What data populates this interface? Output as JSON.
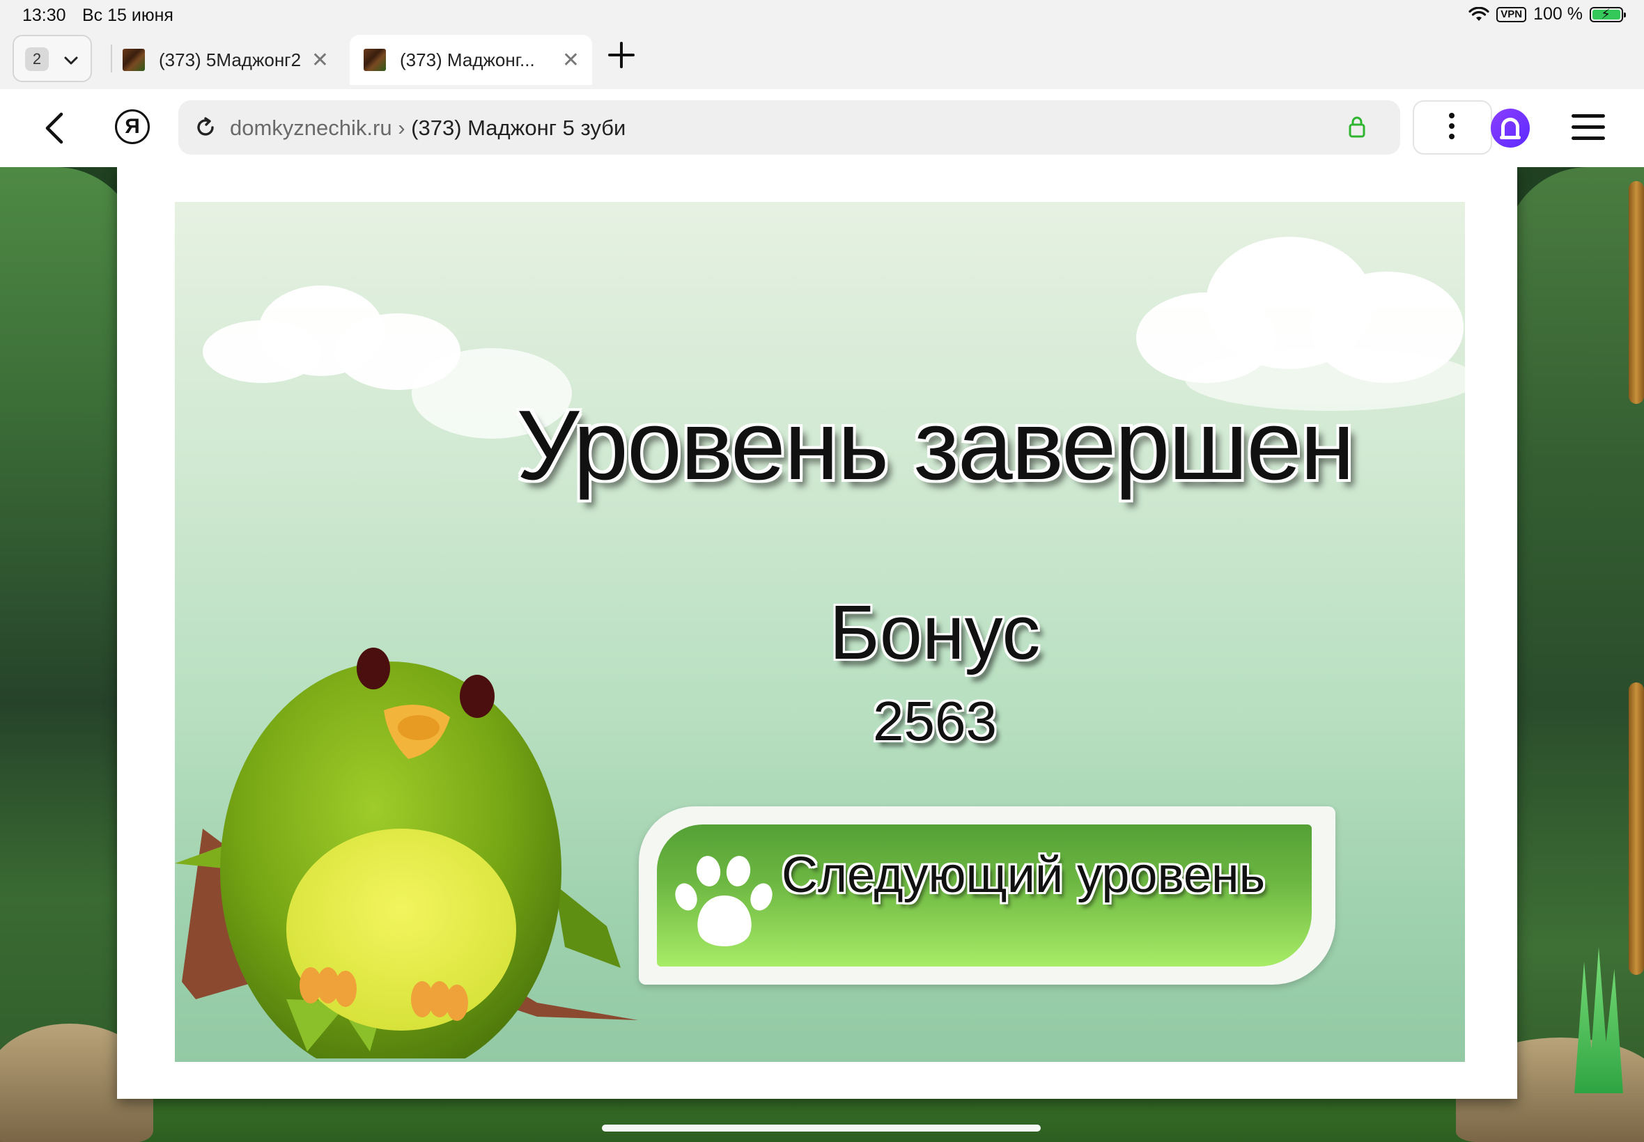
{
  "status_bar": {
    "time": "13:30",
    "date": "Вс 15 июня",
    "vpn": "VPN",
    "battery_text": "100 %",
    "battery_level": 1.0
  },
  "tabs": {
    "count": "2",
    "items": [
      {
        "title": "(373) 5Маджонг2",
        "active": false
      },
      {
        "title": "(373) Маджонг...",
        "active": true
      }
    ]
  },
  "toolbar": {
    "ya_label": "Я",
    "address": {
      "domain": "domkyznechik.ru",
      "separator": " › ",
      "page_title": "(373) Маджонг 5 зуби"
    }
  },
  "game": {
    "headline": "Уровень завершен",
    "bonus_label": "Бонус",
    "bonus_value": "2563",
    "next_button_label": "Следующий уровень"
  },
  "colors": {
    "accent_alice": "#7b3cff",
    "lock_green": "#2fb52f",
    "button_green": "#6cb742"
  },
  "icons": [
    "back-arrow-icon",
    "yandex-icon",
    "reload-icon",
    "lock-icon",
    "more-dots-icon",
    "alice-icon",
    "hamburger-icon",
    "paw-icon",
    "close-icon",
    "plus-icon",
    "wifi-icon",
    "battery-icon"
  ]
}
